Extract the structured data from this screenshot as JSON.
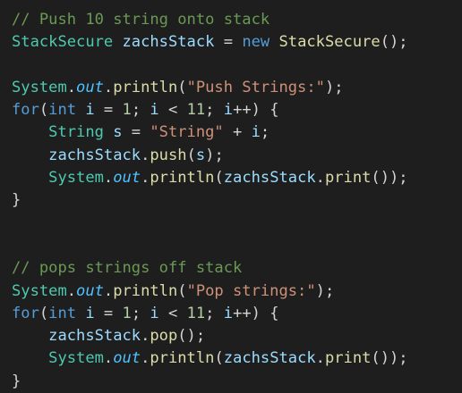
{
  "colors": {
    "background": "#1e1e1e",
    "comment": "#6a9955",
    "keyword": "#569cd6",
    "type": "#4ec9b0",
    "variable": "#9cdcfe",
    "function": "#dcdcaa",
    "string": "#ce9178",
    "number": "#b5cea8",
    "text": "#d4d4d4",
    "static_field": "#4fc1ff"
  },
  "lines": [
    [
      {
        "t": "comment",
        "v": "// Push 10 string onto stack"
      }
    ],
    [
      {
        "t": "type",
        "v": "StackSecure"
      },
      {
        "t": "op",
        "v": " "
      },
      {
        "t": "var",
        "v": "zachsStack"
      },
      {
        "t": "op",
        "v": " = "
      },
      {
        "t": "keyword",
        "v": "new"
      },
      {
        "t": "op",
        "v": " "
      },
      {
        "t": "fn",
        "v": "StackSecure"
      },
      {
        "t": "op",
        "v": "();"
      }
    ],
    [],
    [
      {
        "t": "system",
        "v": "System"
      },
      {
        "t": "op",
        "v": "."
      },
      {
        "t": "static",
        "v": "out"
      },
      {
        "t": "op",
        "v": "."
      },
      {
        "t": "fn",
        "v": "println"
      },
      {
        "t": "op",
        "v": "("
      },
      {
        "t": "string",
        "v": "\"Push Strings:\""
      },
      {
        "t": "op",
        "v": ");"
      }
    ],
    [
      {
        "t": "keyword",
        "v": "for"
      },
      {
        "t": "op",
        "v": "("
      },
      {
        "t": "keyword",
        "v": "int"
      },
      {
        "t": "op",
        "v": " "
      },
      {
        "t": "var",
        "v": "i"
      },
      {
        "t": "op",
        "v": " = "
      },
      {
        "t": "number",
        "v": "1"
      },
      {
        "t": "op",
        "v": "; "
      },
      {
        "t": "var",
        "v": "i"
      },
      {
        "t": "op",
        "v": " < "
      },
      {
        "t": "number",
        "v": "11"
      },
      {
        "t": "op",
        "v": "; "
      },
      {
        "t": "var",
        "v": "i"
      },
      {
        "t": "op",
        "v": "++) {"
      }
    ],
    [
      {
        "t": "op",
        "v": "    "
      },
      {
        "t": "type",
        "v": "String"
      },
      {
        "t": "op",
        "v": " "
      },
      {
        "t": "var",
        "v": "s"
      },
      {
        "t": "op",
        "v": " = "
      },
      {
        "t": "string",
        "v": "\"String\""
      },
      {
        "t": "op",
        "v": " + "
      },
      {
        "t": "var",
        "v": "i"
      },
      {
        "t": "op",
        "v": ";"
      }
    ],
    [
      {
        "t": "op",
        "v": "    "
      },
      {
        "t": "var",
        "v": "zachsStack"
      },
      {
        "t": "op",
        "v": "."
      },
      {
        "t": "fn",
        "v": "push"
      },
      {
        "t": "op",
        "v": "("
      },
      {
        "t": "var",
        "v": "s"
      },
      {
        "t": "op",
        "v": ");"
      }
    ],
    [
      {
        "t": "op",
        "v": "    "
      },
      {
        "t": "system",
        "v": "System"
      },
      {
        "t": "op",
        "v": "."
      },
      {
        "t": "static",
        "v": "out"
      },
      {
        "t": "op",
        "v": "."
      },
      {
        "t": "fn",
        "v": "println"
      },
      {
        "t": "op",
        "v": "("
      },
      {
        "t": "var",
        "v": "zachsStack"
      },
      {
        "t": "op",
        "v": "."
      },
      {
        "t": "fn",
        "v": "print"
      },
      {
        "t": "op",
        "v": "());"
      }
    ],
    [
      {
        "t": "op",
        "v": "}"
      }
    ],
    [],
    [],
    [
      {
        "t": "comment",
        "v": "// pops strings off stack"
      }
    ],
    [
      {
        "t": "system",
        "v": "System"
      },
      {
        "t": "op",
        "v": "."
      },
      {
        "t": "static",
        "v": "out"
      },
      {
        "t": "op",
        "v": "."
      },
      {
        "t": "fn",
        "v": "println"
      },
      {
        "t": "op",
        "v": "("
      },
      {
        "t": "string",
        "v": "\"Pop strings:\""
      },
      {
        "t": "op",
        "v": ");"
      }
    ],
    [
      {
        "t": "keyword",
        "v": "for"
      },
      {
        "t": "op",
        "v": "("
      },
      {
        "t": "keyword",
        "v": "int"
      },
      {
        "t": "op",
        "v": " "
      },
      {
        "t": "var",
        "v": "i"
      },
      {
        "t": "op",
        "v": " = "
      },
      {
        "t": "number",
        "v": "1"
      },
      {
        "t": "op",
        "v": "; "
      },
      {
        "t": "var",
        "v": "i"
      },
      {
        "t": "op",
        "v": " < "
      },
      {
        "t": "number",
        "v": "11"
      },
      {
        "t": "op",
        "v": "; "
      },
      {
        "t": "var",
        "v": "i"
      },
      {
        "t": "op",
        "v": "++) {"
      }
    ],
    [
      {
        "t": "op",
        "v": "    "
      },
      {
        "t": "var",
        "v": "zachsStack"
      },
      {
        "t": "op",
        "v": "."
      },
      {
        "t": "fn",
        "v": "pop"
      },
      {
        "t": "op",
        "v": "();"
      }
    ],
    [
      {
        "t": "op",
        "v": "    "
      },
      {
        "t": "system",
        "v": "System"
      },
      {
        "t": "op",
        "v": "."
      },
      {
        "t": "static",
        "v": "out"
      },
      {
        "t": "op",
        "v": "."
      },
      {
        "t": "fn",
        "v": "println"
      },
      {
        "t": "op",
        "v": "("
      },
      {
        "t": "var",
        "v": "zachsStack"
      },
      {
        "t": "op",
        "v": "."
      },
      {
        "t": "fn",
        "v": "print"
      },
      {
        "t": "op",
        "v": "());"
      }
    ],
    [
      {
        "t": "op",
        "v": "}"
      }
    ]
  ]
}
